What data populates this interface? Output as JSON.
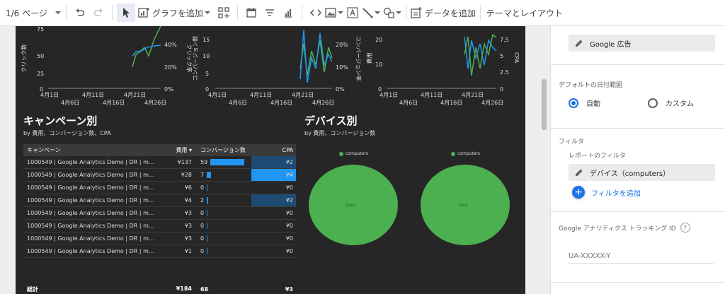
{
  "toolbar": {
    "page_indicator": "1/6 ページ",
    "add_chart": "グラフを追加",
    "add_data": "データを追加",
    "theme_layout": "テーマとレイアウト"
  },
  "mini_charts": [
    {
      "y_label": "クリック数",
      "y2_label": "クリック率",
      "y_ticks": [
        "75",
        "50",
        "25",
        "0"
      ],
      "y2_ticks": [
        "40%",
        "20%",
        "0%"
      ],
      "x_ticks_top": [
        "4月1日",
        "4月11日",
        "4月21日"
      ],
      "x_ticks_bottom": [
        "4月6日",
        "4月16日",
        "4月26日"
      ]
    },
    {
      "y_label": "コンバージョン数",
      "y2_label": "コンバージョン率",
      "y_ticks": [
        "15",
        "10",
        "5",
        "0"
      ],
      "y2_ticks": [
        "20%",
        "10%",
        "0%"
      ],
      "x_ticks_top": [
        "4月1日",
        "4月11日",
        "4月21日"
      ],
      "x_ticks_bottom": [
        "4月6日",
        "4月16日",
        "4月26日"
      ]
    },
    {
      "y_label": "費用",
      "y2_label": "CPA",
      "y_ticks": [
        "20",
        "10",
        "0"
      ],
      "y2_ticks": [
        "7.5",
        "5",
        "2.5",
        "0"
      ],
      "x_ticks_top": [
        "4月1日",
        "4月11日",
        "4月21日"
      ],
      "x_ticks_bottom": [
        "4月6日",
        "4月16日",
        "4月26日"
      ]
    }
  ],
  "campaign_section": {
    "title": "キャンペーン別",
    "subtitle": "by 費用、コンバージョン数、CPA"
  },
  "device_section": {
    "title": "デバイス別",
    "subtitle": "by 費用、コンバージョン数"
  },
  "table": {
    "headers": {
      "campaign": "キャンペーン",
      "cost": "費用 ▾",
      "conversions": "コンバージョン数",
      "cpa": "CPA"
    },
    "rows": [
      {
        "campaign": "1000549 | Google Analytics Demo | DR | m...",
        "cost": "¥137",
        "conversions": "59",
        "conv_value": 59,
        "cpa": "¥2",
        "cpa_highlight": "strong"
      },
      {
        "campaign": "1000549 | Google Analytics Demo | DR | m...",
        "cost": "¥28",
        "conversions": "7",
        "conv_value": 7,
        "cpa": "¥4",
        "cpa_highlight": "bright"
      },
      {
        "campaign": "1000549 | Google Analytics Demo | DR | m...",
        "cost": "¥6",
        "conversions": "0",
        "conv_value": 0,
        "cpa": "¥0",
        "cpa_highlight": "none"
      },
      {
        "campaign": "1000549 | Google Analytics Demo | DR | m...",
        "cost": "¥4",
        "conversions": "2",
        "conv_value": 2,
        "cpa": "¥2",
        "cpa_highlight": "strong"
      },
      {
        "campaign": "1000549 | Google Analytics Demo | DR | m...",
        "cost": "¥3",
        "conversions": "0",
        "conv_value": 0,
        "cpa": "¥0",
        "cpa_highlight": "none"
      },
      {
        "campaign": "1000549 | Google Analytics Demo | DR | m...",
        "cost": "¥3",
        "conversions": "0",
        "conv_value": 0,
        "cpa": "¥0",
        "cpa_highlight": "none"
      },
      {
        "campaign": "1000549 | Google Analytics Demo | DR | m...",
        "cost": "¥3",
        "conversions": "0",
        "conv_value": 0,
        "cpa": "¥0",
        "cpa_highlight": "none"
      },
      {
        "campaign": "1000549 | Google Analytics Demo | DR | m...",
        "cost": "¥1",
        "conversions": "0",
        "conv_value": 0,
        "cpa": "¥0",
        "cpa_highlight": "none"
      }
    ],
    "total": {
      "label": "総計",
      "cost": "¥184",
      "conversions": "68",
      "cpa": "¥3"
    },
    "bar_max": 59
  },
  "pies": [
    {
      "legend": "computers",
      "label": "100%",
      "color": "#4caf50"
    },
    {
      "legend": "computers",
      "label": "100%",
      "color": "#4caf50"
    }
  ],
  "panel": {
    "data_source_chip": "Google 広告",
    "date_range_label": "デフォルトの日付範囲",
    "radio_auto": "自動",
    "radio_custom": "カスタム",
    "filter_heading": "フィルタ",
    "report_filter_label": "レポートのフィルタ",
    "filter_chip": "デバイス（computers）",
    "add_filter": "フィルタを追加",
    "ga_tracking_label": "Google アナリティクス トラッキング ID",
    "ga_tracking_placeholder": "UA-XXXXX-Y",
    "help_mark": "?"
  },
  "colors": {
    "accent": "#1a73e8",
    "bar": "#2196f3",
    "green": "#4caf50",
    "report_bg": "#262626"
  }
}
